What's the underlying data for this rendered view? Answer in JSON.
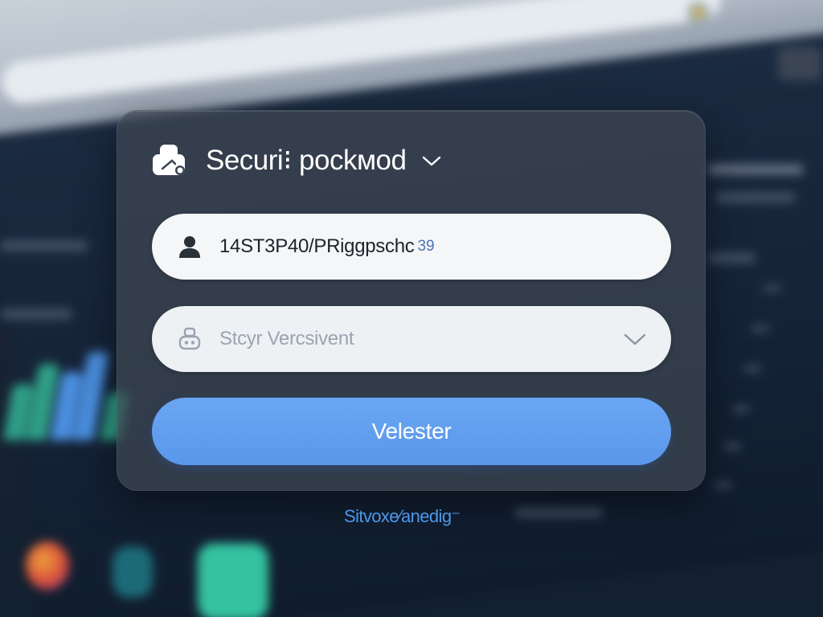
{
  "dialog": {
    "title": "Securi⁝ pockмod",
    "title_icon": "user-card-icon",
    "title_chevron_icon": "chevron-down-icon"
  },
  "username_field": {
    "icon": "user-icon",
    "value": "14ST3P40/PRiggpschc",
    "suffix": "39"
  },
  "select_field": {
    "icon": "robot-icon",
    "placeholder": "Stcyr Vercsivent",
    "chevron_icon": "chevron-down-icon"
  },
  "submit": {
    "label": "Velester",
    "color": "#5b98eb"
  },
  "footer": {
    "link_text": "Sitvoxe⁄anedig⁻"
  },
  "colors": {
    "dialog_background": "#3e4652",
    "field_background": "#f4f6f8",
    "accent": "#5b98eb",
    "link": "#4d97ea"
  }
}
